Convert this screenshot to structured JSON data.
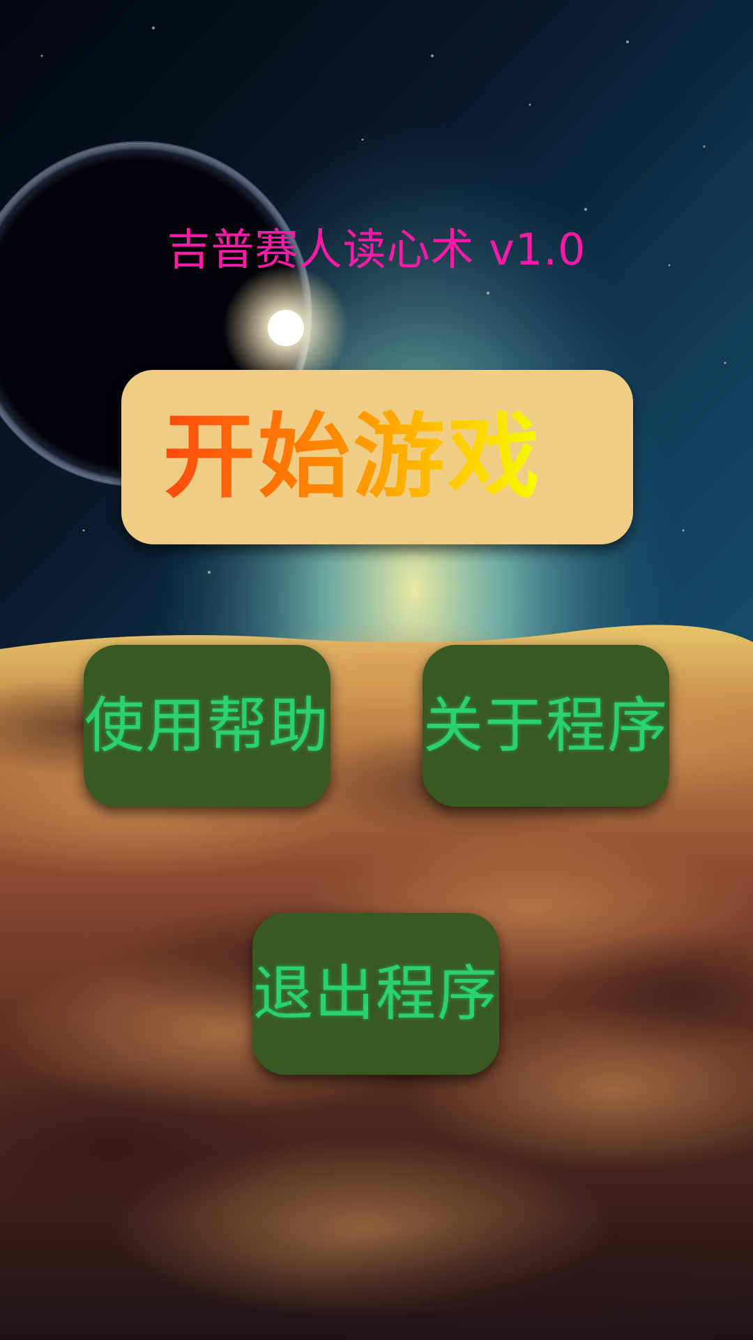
{
  "title": "吉普赛人读心术 v1.0",
  "buttons": {
    "start": "开始游戏",
    "help": "使用帮助",
    "about": "关于程序",
    "exit": "退出程序"
  },
  "colors": {
    "title": "#ff1aa8",
    "start_button_bg": "#f0cd85",
    "menu_button_bg": "#385a22",
    "menu_button_text": "#2bd16a"
  }
}
